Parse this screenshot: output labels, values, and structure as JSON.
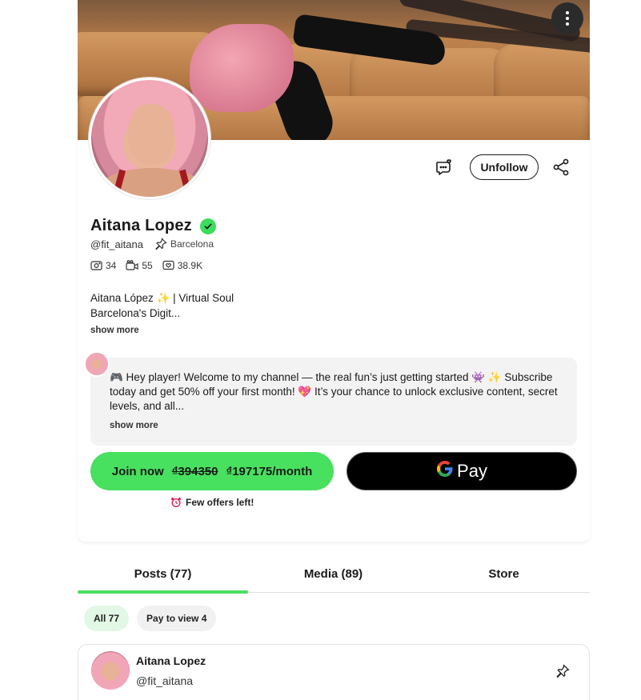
{
  "profile": {
    "name": "Aitana Lopez",
    "handle": "@fit_aitana",
    "location": "Barcelona",
    "stats": {
      "photos": "34",
      "videos": "55",
      "likes": "38.9K"
    },
    "bio_line1": "Aitana López ✨ | Virtual Soul",
    "bio_line2": "Barcelona's Digit...",
    "bio_show_more": "show more"
  },
  "actions": {
    "unfollow_label": "Unfollow"
  },
  "welcome": {
    "text": "🎮 Hey player! Welcome to my channel — the real fun’s just getting started 👾 ✨ Subscribe today and get 50% off your first month! 💖 It’s your chance to unlock exclusive content, secret levels, and all...",
    "show_more": "show more"
  },
  "subscribe": {
    "join_label": "Join now",
    "old_price": "₫394350",
    "new_price": "₫197175/month",
    "gpay_g": "G",
    "gpay_label": "Pay",
    "offers_text": "Few offers left!"
  },
  "tabs": [
    {
      "label": "Posts (77)"
    },
    {
      "label": "Media (89)"
    },
    {
      "label": "Store"
    }
  ],
  "filters": [
    {
      "label": "All 77"
    },
    {
      "label": "Pay to view 4"
    }
  ],
  "post": {
    "name": "Aitana Lopez",
    "handle": "@fit_aitana"
  },
  "colors": {
    "accent_green": "#48e05f",
    "verified_green": "#3ddc5c",
    "chip_active_bg": "#e2f7e5"
  }
}
